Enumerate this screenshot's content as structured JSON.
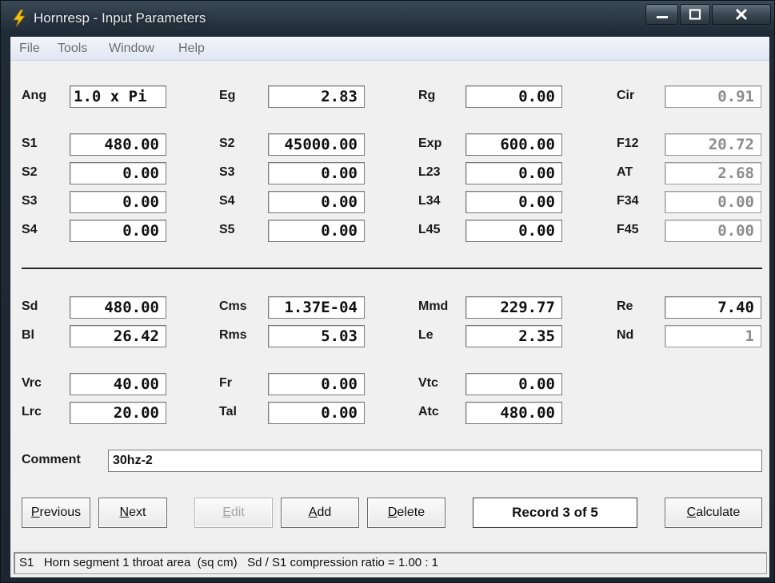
{
  "window": {
    "title": "Hornresp - Input Parameters"
  },
  "menu": [
    "File",
    "Tools",
    "Window",
    "Help"
  ],
  "row0": [
    {
      "label": "Ang",
      "value": "1.0 x Pi"
    },
    {
      "label": "Eg",
      "value": "2.83"
    },
    {
      "label": "Rg",
      "value": "0.00"
    },
    {
      "label": "Cir",
      "value": "0.91"
    }
  ],
  "horn": [
    [
      {
        "label": "S1",
        "value": "480.00"
      },
      {
        "label": "S2",
        "value": "45000.00"
      },
      {
        "label": "Exp",
        "value": "600.00"
      },
      {
        "label": "F12",
        "value": "20.72"
      }
    ],
    [
      {
        "label": "S2",
        "value": "0.00"
      },
      {
        "label": "S3",
        "value": "0.00"
      },
      {
        "label": "L23",
        "value": "0.00"
      },
      {
        "label": "AT",
        "value": "2.68"
      }
    ],
    [
      {
        "label": "S3",
        "value": "0.00"
      },
      {
        "label": "S4",
        "value": "0.00"
      },
      {
        "label": "L34",
        "value": "0.00"
      },
      {
        "label": "F34",
        "value": "0.00"
      }
    ],
    [
      {
        "label": "S4",
        "value": "0.00"
      },
      {
        "label": "S5",
        "value": "0.00"
      },
      {
        "label": "L45",
        "value": "0.00"
      },
      {
        "label": "F45",
        "value": "0.00"
      }
    ]
  ],
  "driver": [
    [
      {
        "label": "Sd",
        "value": "480.00"
      },
      {
        "label": "Cms",
        "value": "1.37E-04"
      },
      {
        "label": "Mmd",
        "value": "229.77"
      },
      {
        "label": "Re",
        "value": "7.40"
      }
    ],
    [
      {
        "label": "Bl",
        "value": "26.42"
      },
      {
        "label": "Rms",
        "value": "5.03"
      },
      {
        "label": "Le",
        "value": "2.35"
      },
      {
        "label": "Nd",
        "value": "1"
      }
    ]
  ],
  "chamber": [
    [
      {
        "label": "Vrc",
        "value": "40.00"
      },
      {
        "label": "Fr",
        "value": "0.00"
      },
      {
        "label": "Vtc",
        "value": "0.00"
      }
    ],
    [
      {
        "label": "Lrc",
        "value": "20.00"
      },
      {
        "label": "Tal",
        "value": "0.00"
      },
      {
        "label": "Atc",
        "value": "480.00"
      }
    ]
  ],
  "comment": {
    "label": "Comment",
    "value": "30hz-2"
  },
  "buttons": {
    "previous": {
      "first": "P",
      "rest": "revious"
    },
    "next": {
      "first": "N",
      "rest": "ext"
    },
    "edit": {
      "first": "E",
      "rest": "dit"
    },
    "add": {
      "first": "A",
      "rest": "dd"
    },
    "delete": {
      "first": "D",
      "rest": "elete"
    },
    "calculate": {
      "first": "C",
      "rest": "alculate"
    }
  },
  "record": "Record 3 of 5",
  "status": "S1   Horn segment 1 throat area  (sq cm)   Sd / S1 compression ratio = 1.00 : 1"
}
